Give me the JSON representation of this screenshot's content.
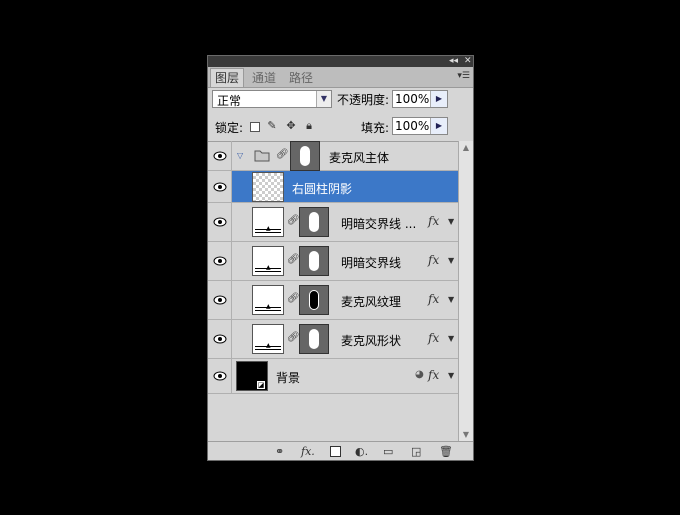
{
  "tabs": [
    "图层",
    "通道",
    "路径"
  ],
  "blend_mode": "正常",
  "opacity_label": "不透明度:",
  "opacity_value": "100%",
  "lock_label": "锁定:",
  "fill_label": "填充:",
  "fill_value": "100%",
  "layers": [
    {
      "name": "麦克风主体"
    },
    {
      "name": "右圆柱阴影"
    },
    {
      "name": "明暗交界线 ..."
    },
    {
      "name": "明暗交界线"
    },
    {
      "name": "麦克风纹理"
    },
    {
      "name": "麦克风形状"
    },
    {
      "name": "背景"
    }
  ],
  "colors": {
    "selection": "#3c78c8"
  },
  "icons": [
    "collapse-icon",
    "close-icon",
    "panel-menu-icon",
    "eye-icon",
    "folder-icon",
    "link-icon",
    "fx-icon",
    "lock-icon",
    "brush-icon",
    "move-icon",
    "trash-icon",
    "new-layer-icon",
    "group-icon",
    "adjustment-icon",
    "mask-icon"
  ]
}
